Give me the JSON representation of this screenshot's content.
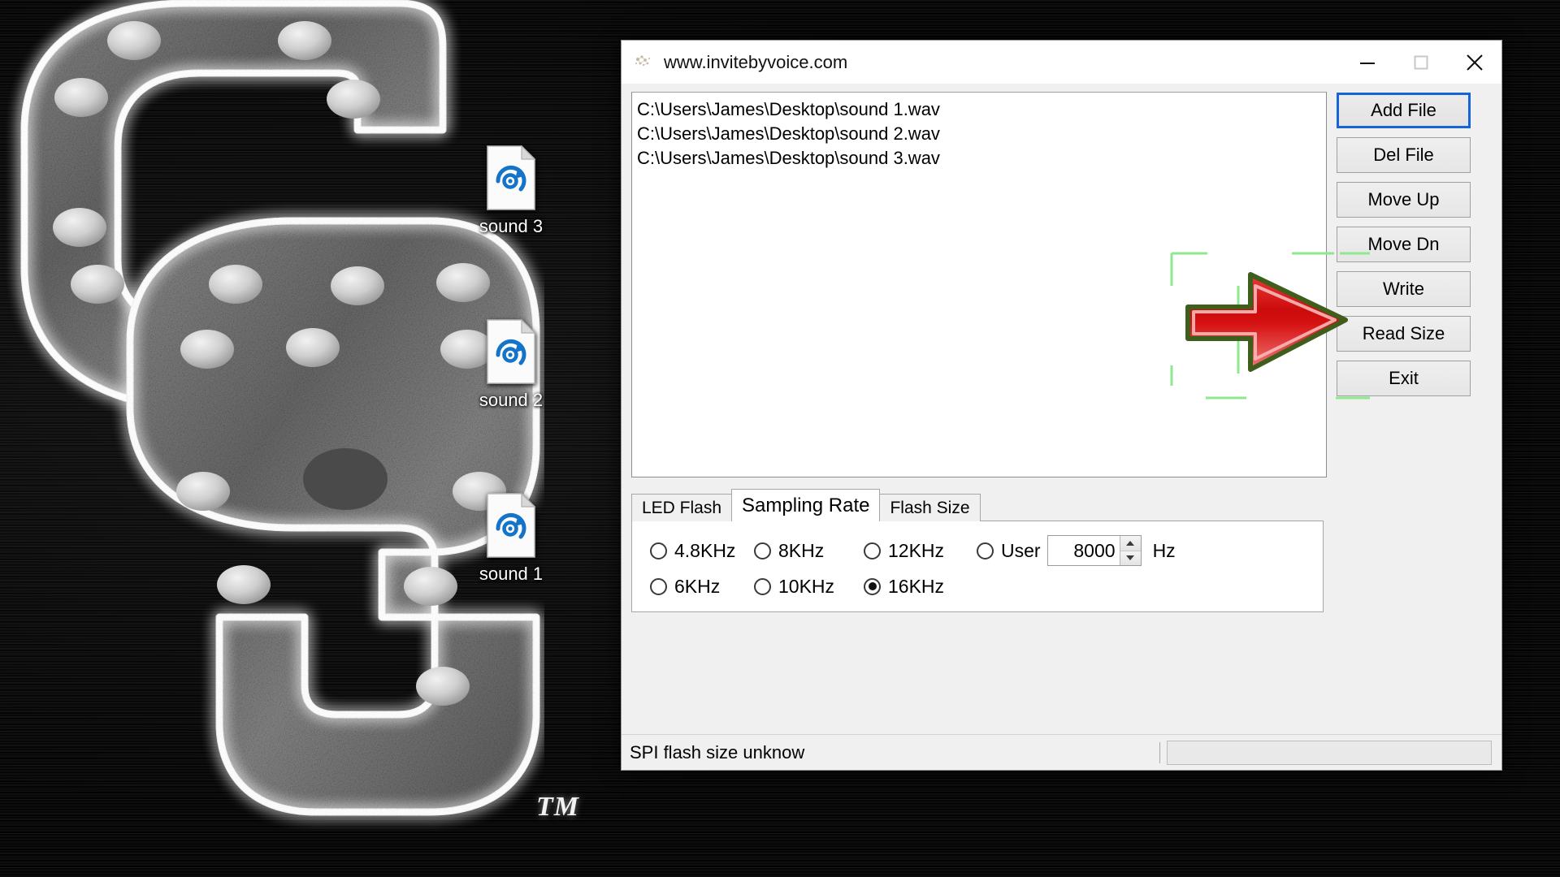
{
  "window": {
    "title": "www.invitebyvoice.com",
    "title_icon": "app-icon",
    "controls": {
      "minimize": "minimize-icon",
      "maximize": "maximize-icon",
      "close": "close-icon"
    }
  },
  "file_list": {
    "items": [
      "C:\\Users\\James\\Desktop\\sound 1.wav",
      "C:\\Users\\James\\Desktop\\sound 2.wav",
      "C:\\Users\\James\\Desktop\\sound 3.wav"
    ]
  },
  "buttons": [
    {
      "label": "Add File",
      "focused": true
    },
    {
      "label": "Del File",
      "focused": false
    },
    {
      "label": "Move Up",
      "focused": false
    },
    {
      "label": "Move Dn",
      "focused": false
    },
    {
      "label": "Write",
      "focused": false
    },
    {
      "label": "Read Size",
      "focused": false
    },
    {
      "label": "Exit",
      "focused": false
    }
  ],
  "tabs": [
    {
      "label": "LED Flash",
      "active": false
    },
    {
      "label": "Sampling Rate",
      "active": true
    },
    {
      "label": "Flash Size",
      "active": false
    }
  ],
  "sampling_rate": {
    "row1": [
      {
        "label": "4.8KHz",
        "checked": false
      },
      {
        "label": "8KHz",
        "checked": false
      },
      {
        "label": "12KHz",
        "checked": false
      }
    ],
    "row2": [
      {
        "label": "6KHz",
        "checked": false
      },
      {
        "label": "10KHz",
        "checked": false
      },
      {
        "label": "16KHz",
        "checked": true
      }
    ],
    "user": {
      "label": "User",
      "checked": false,
      "value": "8000",
      "unit": "Hz"
    }
  },
  "statusbar": {
    "message": "SPI flash size unknow",
    "progress_value": ""
  },
  "desktop": {
    "trademark": "TM",
    "icons": [
      {
        "label": "sound 3",
        "glyph": "audio-file-icon"
      },
      {
        "label": "sound 2",
        "glyph": "audio-file-icon"
      },
      {
        "label": "sound 1",
        "glyph": "audio-file-icon"
      }
    ]
  },
  "annotation": {
    "arrow": "red-arrow-pointing-right",
    "handles": "green-selection-handles"
  },
  "colors": {
    "focus_border": "#1565d8",
    "window_bg": "#f0f0f0",
    "titlebar_bg": "#ffffff",
    "arrow_fill": "#d81414",
    "arrow_outline": "#3f5e1b",
    "handle_green": "#8fe88f",
    "icon_blue": "#1474c9"
  }
}
